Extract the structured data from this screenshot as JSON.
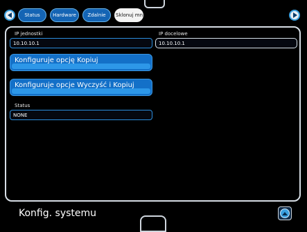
{
  "tabs": [
    {
      "label": "Status"
    },
    {
      "label": "Hardware"
    },
    {
      "label": "Zdalnie"
    },
    {
      "label": "Sklonuj mnie"
    }
  ],
  "form": {
    "unit_ip_label": "IP jednostki",
    "unit_ip_value": "10.10.10.1",
    "target_ip_label": "IP docelowe",
    "target_ip_value": "10.10.10.1",
    "btn_copy": "Konfiguruje opcję Kopiuj",
    "btn_clear_copy": "Konfiguruje opcje Wyczyść i Kopiuj",
    "status_label": "Status",
    "status_value": "NONE"
  },
  "footer": {
    "title": "Konfig. systemu"
  },
  "icons": {
    "nav_left": "arrow-left-icon",
    "nav_right": "arrow-right-icon",
    "footer": "arrow-up-icon"
  },
  "colors": {
    "accent": "#1370c8",
    "accent_light": "#2d97e8",
    "border": "#d7dee6",
    "background": "#000000"
  }
}
